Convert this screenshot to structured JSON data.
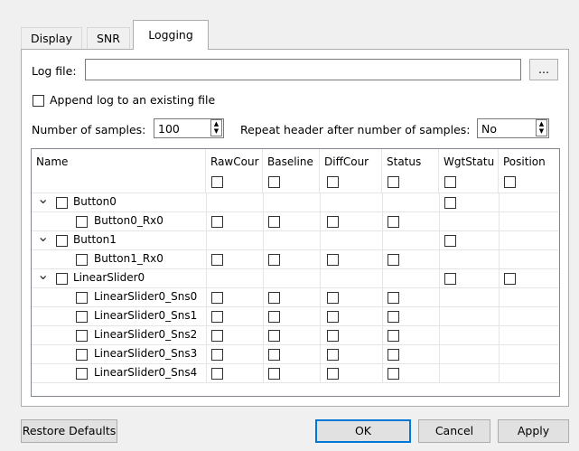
{
  "tabs": [
    {
      "label": "Display"
    },
    {
      "label": "SNR"
    },
    {
      "label": "Logging"
    }
  ],
  "log_file": {
    "label": "Log file:",
    "value": "",
    "browse_label": "..."
  },
  "append": {
    "label": "Append log to an existing file",
    "checked": false
  },
  "samples": {
    "label": "Number of samples:",
    "value": "100"
  },
  "repeat": {
    "label": "Repeat header after number of samples:",
    "value": "No"
  },
  "table": {
    "columns": [
      "Name",
      "RawCour",
      "Baseline",
      "DiffCour",
      "Status",
      "WgtStatu",
      "Position"
    ],
    "rows": [
      {
        "name": "Button0",
        "level": 0,
        "expander": "⌵"
      },
      {
        "name": "Button0_Rx0",
        "level": 1
      },
      {
        "name": "Button1",
        "level": 0
      },
      {
        "name": "Button1_Rx0",
        "level": 1
      },
      {
        "name": "LinearSlider0",
        "level": 0
      },
      {
        "name": "LinearSlider0_Sns0",
        "level": 1
      },
      {
        "name": "LinearSlider0_Sns1",
        "level": 1
      },
      {
        "name": "LinearSlider0_Sns2",
        "level": 1
      },
      {
        "name": "LinearSlider0_Sns3",
        "level": 1
      },
      {
        "name": "LinearSlider0_Sns4",
        "level": 1
      }
    ]
  },
  "buttons": {
    "restore": "Restore Defaults",
    "ok": "OK",
    "cancel": "Cancel",
    "apply": "Apply"
  },
  "icons": {
    "expand": "chevron-down-icon",
    "spin_up": "up-arrow-icon",
    "spin_down": "down-arrow-icon"
  }
}
